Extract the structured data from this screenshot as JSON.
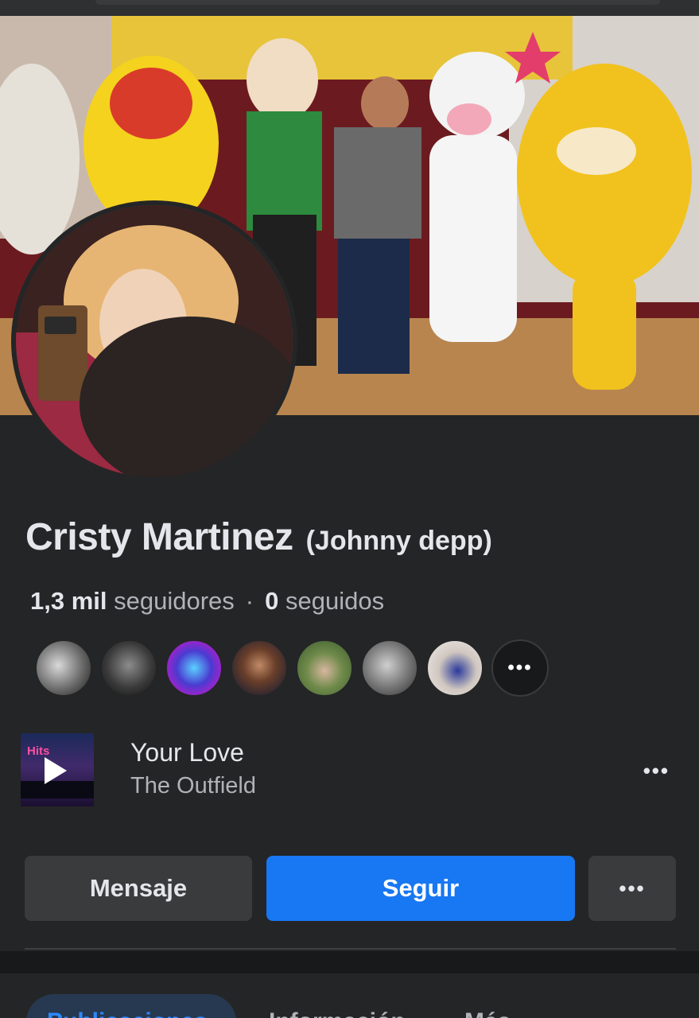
{
  "profile": {
    "name": "Cristy Martinez",
    "alternate_name": "(Johnny depp)",
    "followers_count": "1,3 mil",
    "followers_label": "seguidores",
    "separator": "·",
    "following_count": "0",
    "following_label": "seguidos"
  },
  "followers_preview": {
    "more_label": "•••"
  },
  "music": {
    "album_art_text": "Hits",
    "title": "Your Love",
    "artist": "The Outfield",
    "more_label": "•••"
  },
  "actions": {
    "message": "Mensaje",
    "follow": "Seguir",
    "more": "•••"
  },
  "tabs": [
    {
      "label": "Publicaciones"
    },
    {
      "label": "Información"
    },
    {
      "label": "Más"
    }
  ],
  "colors": {
    "background": "#242526",
    "primary_button": "#1877f2",
    "secondary_button": "#3a3b3c",
    "text_primary": "#e4e6eb",
    "text_secondary": "#b0b3b8"
  }
}
